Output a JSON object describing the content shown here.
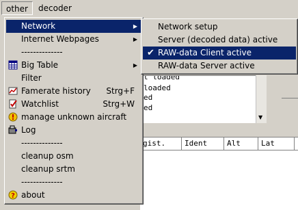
{
  "menubar": {
    "other": "other",
    "decoder": "decoder"
  },
  "main_menu": {
    "network": "Network",
    "internet_webpages": "Internet Webpages",
    "sep1": "--------------",
    "big_table": "Big Table",
    "filter": "Filter",
    "famerate_history": "Famerate history",
    "famerate_shortcut": "Strg+F",
    "watchlist": "Watchlist",
    "watchlist_shortcut": "Strg+W",
    "manage_unknown": "manage unknown aircraft",
    "log": "Log",
    "sep2": "--------------",
    "cleanup_osm": "cleanup osm",
    "cleanup_srtm": "cleanup srtm",
    "sep3": "--------------",
    "about": "about"
  },
  "network_submenu": {
    "network_setup": "Network setup",
    "server_active": "Server (decoded data) active",
    "raw_client_active": "RAW-data Client active",
    "raw_server_active": "RAW-data Server active"
  },
  "log_lines": [
    "t loaded",
    "loaded",
    "ed",
    "ed"
  ],
  "table_headers": [
    "gist.",
    "Ident",
    "Alt",
    "Lat",
    "I"
  ]
}
